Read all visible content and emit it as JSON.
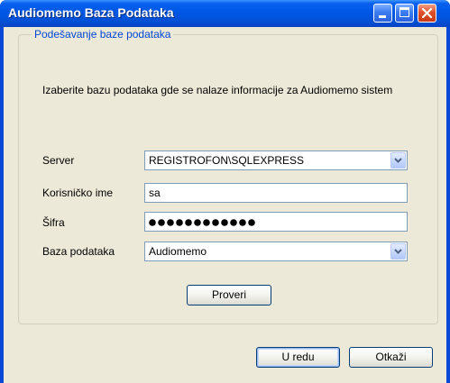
{
  "window": {
    "title": "Audiomemo Baza Podataka",
    "titlebar_buttons": [
      "minimize-icon",
      "maximize-icon",
      "close-icon"
    ]
  },
  "group": {
    "legend": "Podešavanje baze podataka",
    "description": "Izaberite bazu podataka gde se nalaze informacije za Audiomemo sistem"
  },
  "form": {
    "server_label": "Server",
    "server_value": "REGISTROFON\\SQLEXPRESS",
    "username_label": "Korisničko ime",
    "username_value": "sa",
    "password_label": "Šifra",
    "password_mask_count": 12,
    "database_label": "Baza podataka",
    "database_value": "Audiomemo"
  },
  "buttons": {
    "check_label": "Proveri",
    "ok_label": "U redu",
    "cancel_label": "Otkaži"
  },
  "colors": {
    "titlebar": "#0058e6",
    "dialog_bg": "#ece9d8",
    "legend_text": "#0046d5",
    "close_button": "#e0502a"
  }
}
